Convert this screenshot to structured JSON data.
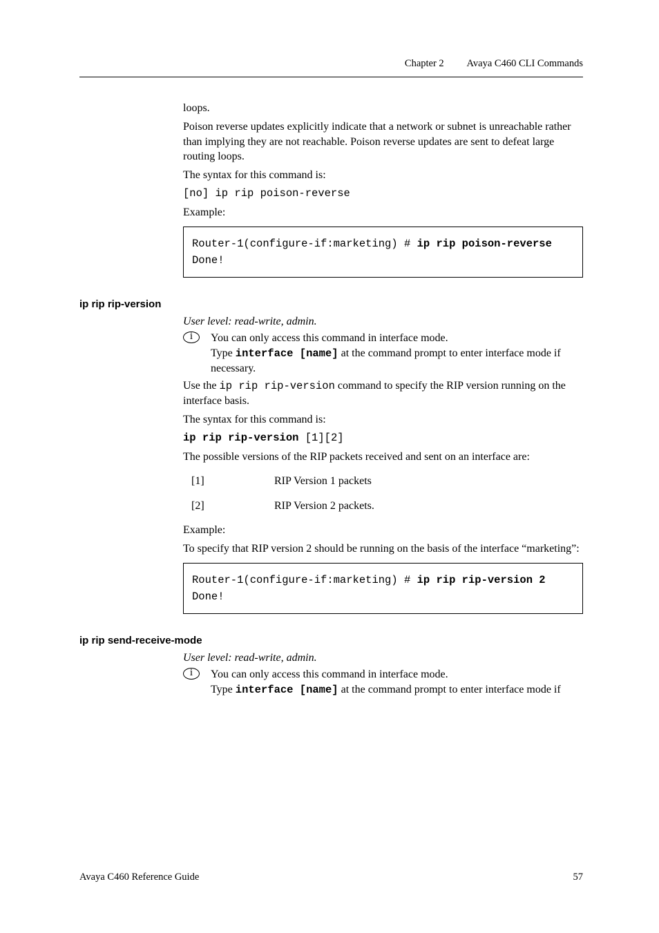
{
  "header": {
    "chapter": "Chapter 2",
    "title": "Avaya C460 CLI Commands"
  },
  "intro": {
    "loops": "loops.",
    "poison_desc": "Poison reverse updates explicitly indicate that a network or subnet is unreachable rather than implying they are not reachable. Poison reverse updates are sent to defeat large routing loops.",
    "syntax_label": "The syntax for this command is:",
    "syntax_cmd": "[no] ip rip poison-reverse",
    "example_label": "Example:",
    "code_line1": "Router-1(configure-if:marketing) # ",
    "code_bold1": "ip rip poison-reverse",
    "code_line2": "Done!"
  },
  "rip_version": {
    "heading": "ip rip rip-version",
    "user_level": "User level: read-write, admin.",
    "info1": "You can only access this command in interface mode.",
    "info2a": "Type ",
    "info2_bold": "interface [name]",
    "info2b": " at the command prompt to enter interface mode if necessary.",
    "use_a": "Use the ",
    "use_cmd": "ip rip rip-version",
    "use_b": " command to specify the RIP version running on the interface basis.",
    "syntax_label": "The syntax for this command is:",
    "syntax_bold": "ip rip rip-version",
    "syntax_tail": " [1][2]",
    "possible": "The possible versions of the RIP packets received and sent on an interface are:",
    "v1_key": "[1]",
    "v1_val": "RIP Version 1 packets",
    "v2_key": "[2]",
    "v2_val": "RIP Version 2 packets.",
    "example_label": "Example:",
    "example_desc": "To specify that RIP version 2 should be running on the basis of the interface “marketing”:",
    "code_line1": "Router-1(configure-if:marketing) # ",
    "code_bold1": "ip rip rip-version 2",
    "code_line2": "Done!"
  },
  "send_receive": {
    "heading": "ip rip send-receive-mode",
    "user_level": "User level: read-write, admin.",
    "info1": "You can only access this command in interface mode.",
    "info2a": "Type ",
    "info2_bold": "interface [name]",
    "info2b": " at the command prompt to enter interface mode if"
  },
  "footer": {
    "left": "Avaya C460 Reference Guide",
    "right": "57"
  },
  "info_glyph": "i"
}
